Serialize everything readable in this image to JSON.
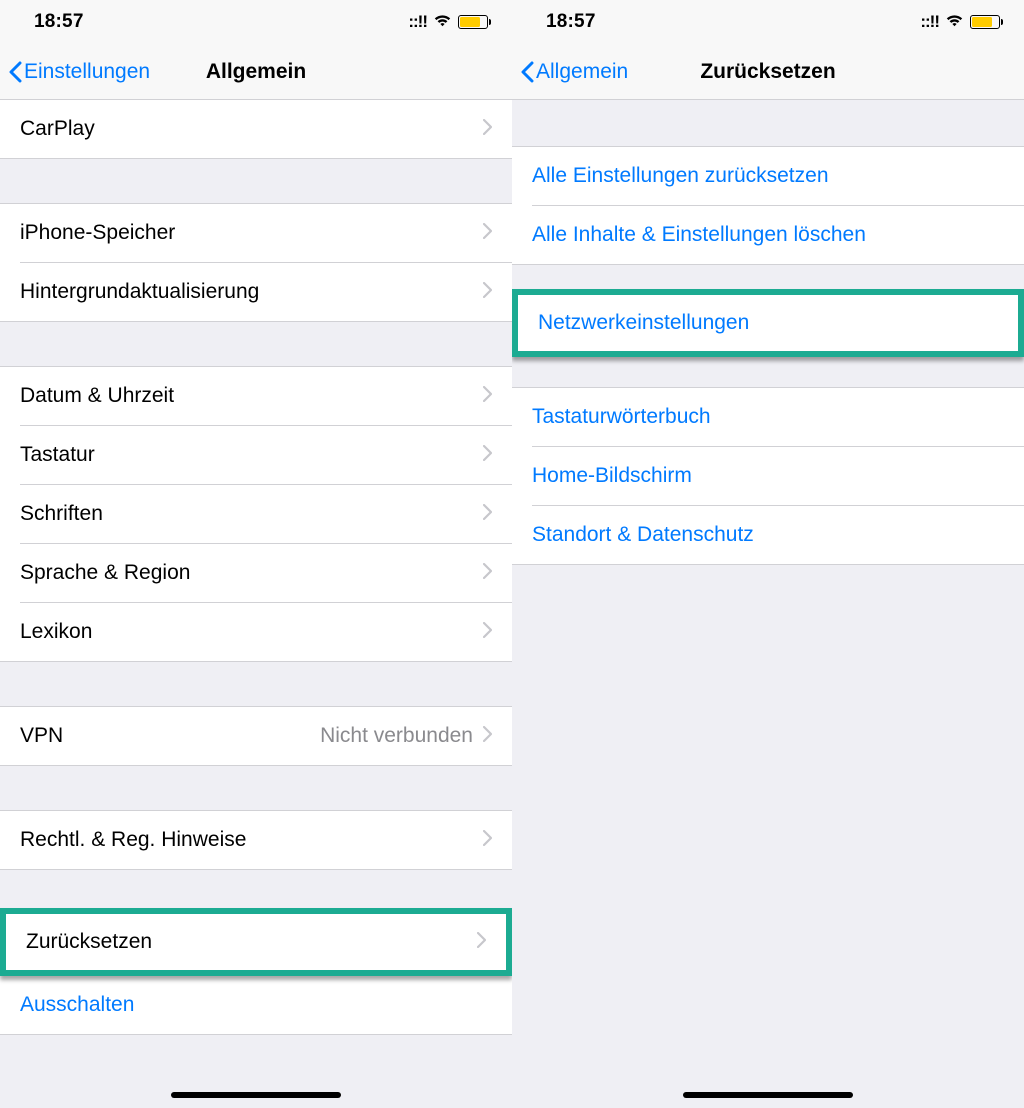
{
  "status": {
    "time": "18:57"
  },
  "left": {
    "back_label": "Einstellungen",
    "title": "Allgemein",
    "rows": {
      "carplay": "CarPlay",
      "storage": "iPhone-Speicher",
      "bgrefresh": "Hintergrundaktualisierung",
      "datetime": "Datum & Uhrzeit",
      "keyboard": "Tastatur",
      "fonts": "Schriften",
      "language": "Sprache & Region",
      "dictionary": "Lexikon",
      "vpn": "VPN",
      "vpn_value": "Nicht verbunden",
      "legal": "Rechtl. & Reg. Hinweise",
      "reset": "Zurücksetzen",
      "shutdown": "Ausschalten"
    }
  },
  "right": {
    "back_label": "Allgemein",
    "title": "Zurücksetzen",
    "rows": {
      "reset_all_settings": "Alle Einstellungen zurücksetzen",
      "erase_all": "Alle Inhalte & Einstellungen löschen",
      "network": "Netzwerkeinstellungen",
      "keyboard_dict": "Tastaturwörterbuch",
      "home_screen": "Home-Bildschirm",
      "location_privacy": "Standort & Datenschutz"
    }
  }
}
